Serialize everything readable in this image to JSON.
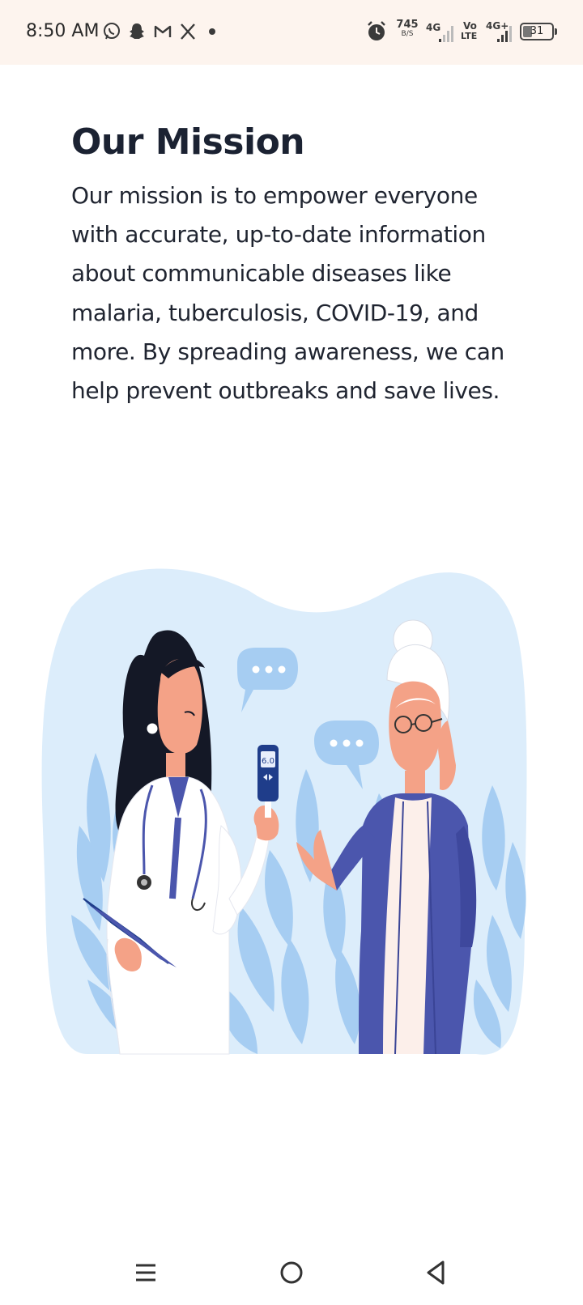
{
  "status_bar": {
    "time": "8:50 AM",
    "notification_icons": [
      "whatsapp-icon",
      "snapchat-icon",
      "gmail-icon",
      "x-icon",
      "dot-icon"
    ],
    "net_speed_value": "745",
    "net_speed_unit": "B/S",
    "signal1_label": "4G",
    "volte_label_top": "Vo",
    "volte_label_bottom": "LTE",
    "signal2_label": "4G+",
    "battery_level": "31",
    "battery_fraction": 0.31
  },
  "content": {
    "title": "Our Mission",
    "body": "Our mission is to empower everyone with accurate, up-to-date information about communicable diseases like malaria, tuberculosis, COVID-19, and more. By spreading awareness, we can help prevent outbreaks and save lives."
  },
  "illustration": {
    "meter_reading": "6.0"
  },
  "nav_bar": {
    "icons": [
      "menu-icon",
      "home-icon",
      "back-icon"
    ]
  },
  "colors": {
    "status_bg": "#fdf4ee",
    "blob": "#dcedfb",
    "leaf": "#a6cdf2",
    "coat_blue": "#4b56ad",
    "text": "#1f2430"
  }
}
